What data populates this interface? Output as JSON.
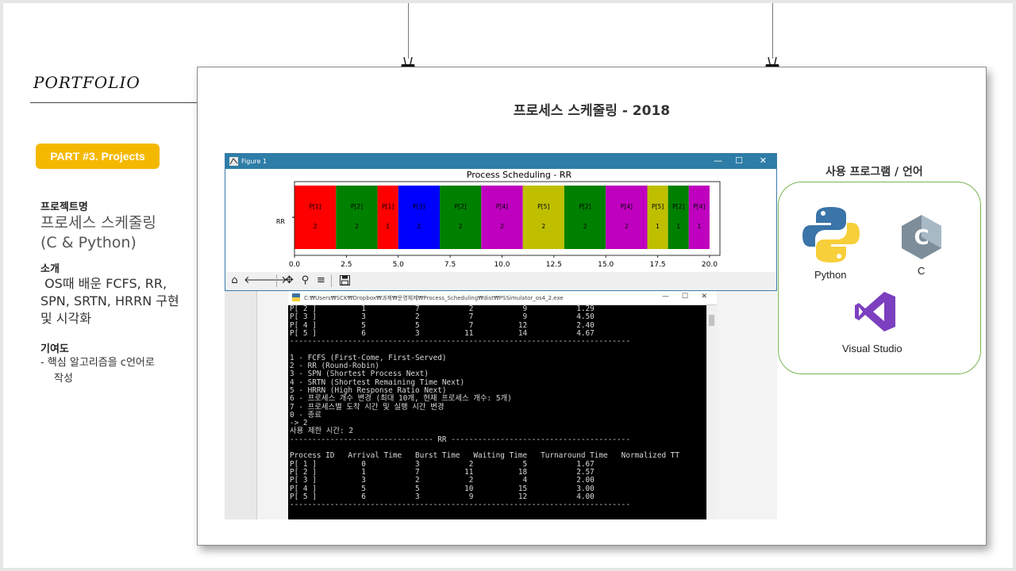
{
  "sidebar": {
    "brand": "PORTFOLIO",
    "part_badge": "PART #3. Projects",
    "project_name_heading": "프로젝트명",
    "project_name_line1": "프로세스 스케줄링",
    "project_name_line2": "(C & Python)",
    "intro_heading": "소개",
    "intro_line1": " OS때 배운 FCFS, RR,",
    "intro_line2": "SPN, SRTN, HRRN 구현",
    "intro_line3": "및 시각화",
    "contribution_heading": "기여도",
    "contribution_line1": "-  핵심 알고리즘을 c언어로",
    "contribution_line2": "작성"
  },
  "slide_title": "프로세스 스케줄링 - 2018",
  "figure_window": {
    "title": "Figure 1",
    "minimize": "—",
    "maximize": "☐",
    "close": "✕"
  },
  "chart_data": {
    "type": "bar",
    "title": "Process Scheduling - RR",
    "ylabel_category": "RR",
    "xlim": [
      0,
      20.5
    ],
    "xticks": [
      "0.0",
      "2.5",
      "5.0",
      "7.5",
      "10.0",
      "12.5",
      "15.0",
      "17.5",
      "20.0"
    ],
    "segments": [
      {
        "label": "P[1]",
        "duration": 2,
        "start": 0,
        "color": "#ff0000"
      },
      {
        "label": "P[2]",
        "duration": 2,
        "start": 2,
        "color": "#008000"
      },
      {
        "label": "P[1]",
        "duration": 1,
        "start": 4,
        "color": "#ff0000"
      },
      {
        "label": "P[3]",
        "duration": 2,
        "start": 5,
        "color": "#0000ff"
      },
      {
        "label": "P[2]",
        "duration": 2,
        "start": 7,
        "color": "#008000"
      },
      {
        "label": "P[4]",
        "duration": 2,
        "start": 9,
        "color": "#bf00bf"
      },
      {
        "label": "P[5]",
        "duration": 2,
        "start": 11,
        "color": "#bfbf00"
      },
      {
        "label": "P[2]",
        "duration": 2,
        "start": 13,
        "color": "#008000"
      },
      {
        "label": "P[4]",
        "duration": 2,
        "start": 15,
        "color": "#bf00bf"
      },
      {
        "label": "P[5]",
        "duration": 1,
        "start": 17,
        "color": "#bfbf00"
      },
      {
        "label": "P[2]",
        "duration": 1,
        "start": 18,
        "color": "#008000"
      },
      {
        "label": "P[4]",
        "duration": 1,
        "start": 19,
        "color": "#bf00bf"
      }
    ]
  },
  "console": {
    "title": "C:₩Users₩SCK₩Dropbox₩과제₩운영체제₩Process_Scheduling₩dist₩PSSimulator_os4_2.exe",
    "minimize": "—",
    "maximize": "☐",
    "close": "✕",
    "text": "P[ 2 ]          1           7           2           9           1.29\nP[ 3 ]          3           2           7           9           4.50\nP[ 4 ]          5           5           7          12           2.40\nP[ 5 ]          6           3          11          14           4.67\n----------------------------------------------------------------------------\n\n1 - FCFS (First-Come, First-Served)\n2 - RR (Round-Robin)\n3 - SPN (Shortest Process Next)\n4 - SRTN (Shortest Remaining Time Next)\n5 - HRRN (High Response Ratio Next)\n6 - 프로세스 개수 변경 (최대 10개, 현재 프로세스 개수: 5개)\n7 - 프로세스별 도착 시간 및 실행 시간 변경\n0 - 종료\n-> 2\n사용 제한 시간: 2\n-------------------------------- RR ----------------------------------------\n\nProcess ID   Arrival Time   Burst Time   Waiting Time   Turnaround Time   Normalized TT\nP[ 1 ]          0           3           2           5           1.67\nP[ 2 ]          1           7          11          18           2.57\nP[ 3 ]          3           2           2           4           2.00\nP[ 4 ]          5           5          10          15           3.00\nP[ 5 ]          6           3           9          12           4.00\n----------------------------------------------------------------------------"
  },
  "tools": {
    "title": "사용 프로그램 / 언어",
    "python": "Python",
    "c": "C",
    "c_logo_letter": "C",
    "visual_studio": "Visual Studio",
    "colors": {
      "python_blue": "#3a74a8",
      "python_yellow": "#f7cf3b",
      "c_gray": "#7d8d99",
      "vs_purple": "#7b3fbf"
    }
  }
}
